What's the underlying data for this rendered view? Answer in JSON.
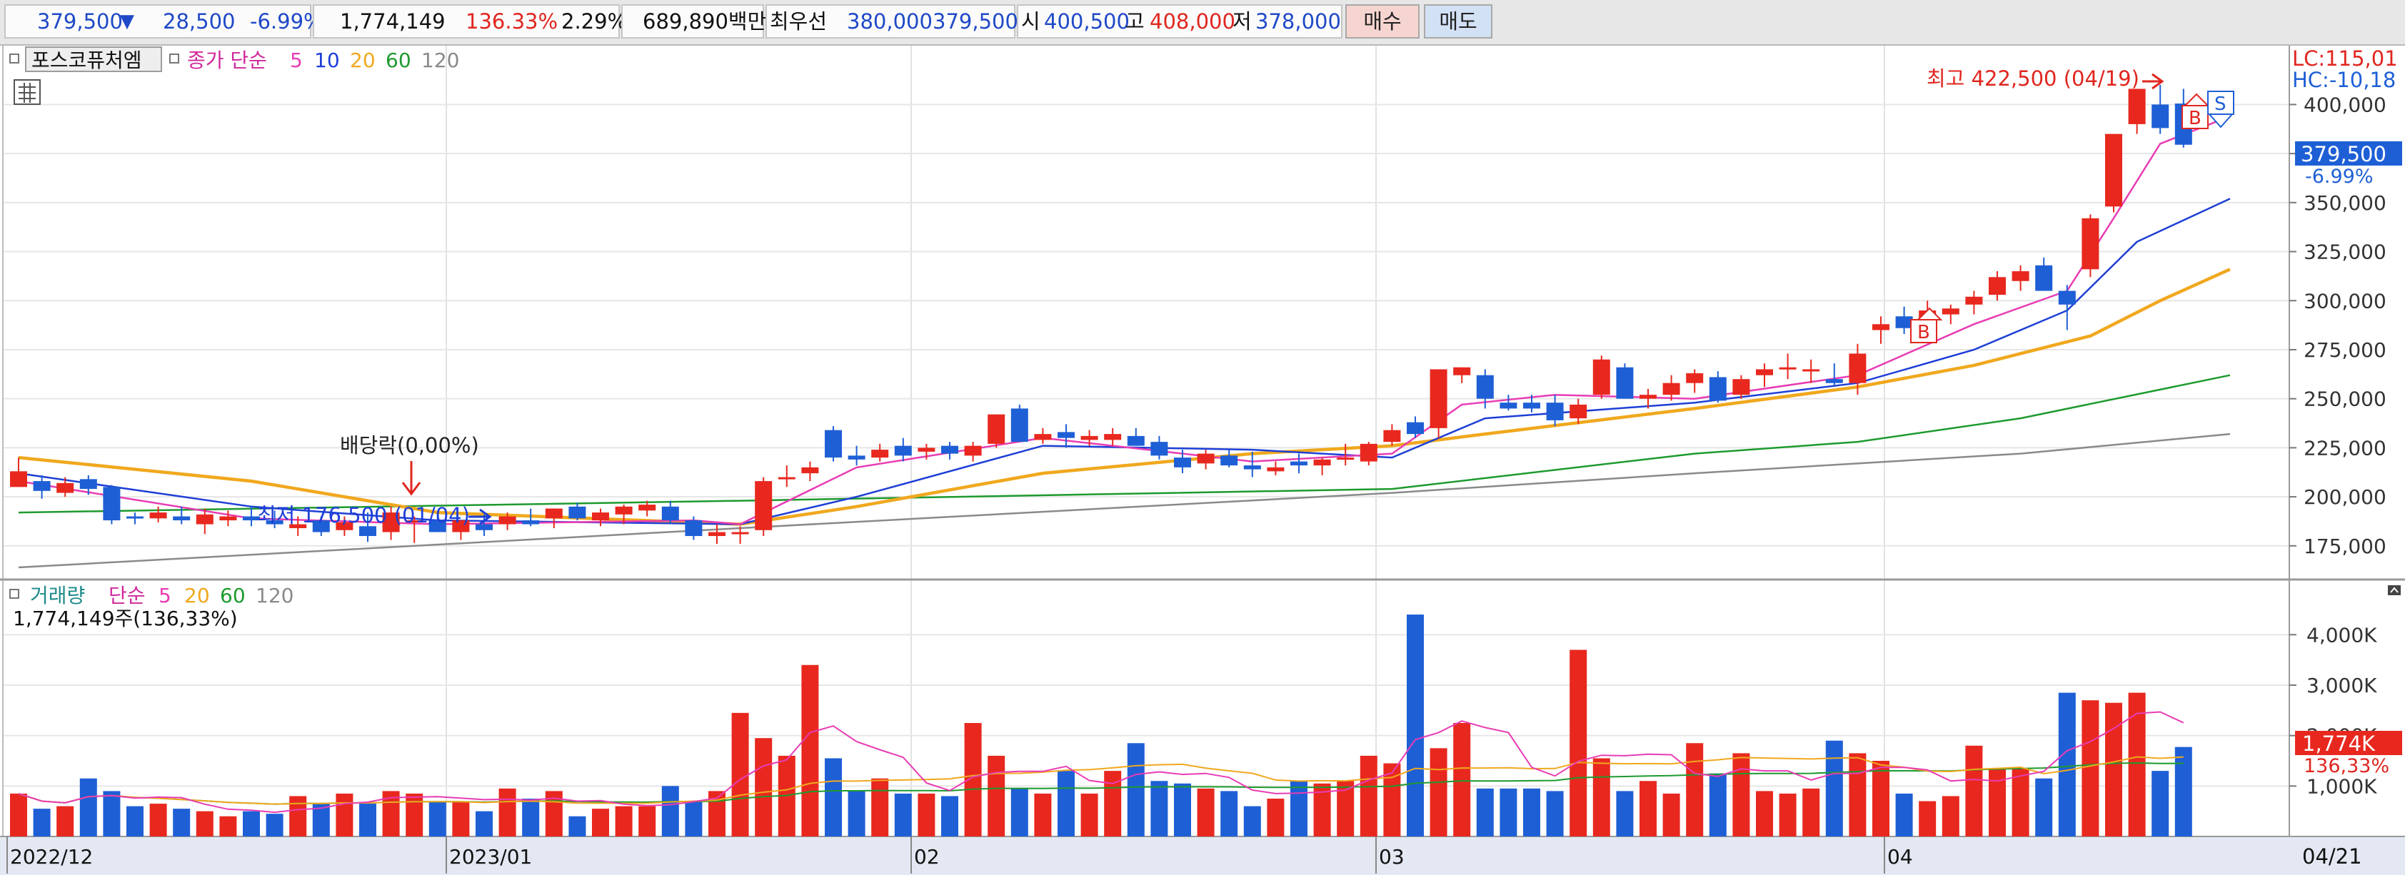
{
  "toolbar": {
    "price": "379,500",
    "change_arrow": "▼",
    "change": "28,500",
    "change_pct": "-6.99%",
    "volume": "1,774,149",
    "volume_ratio": "136.33%",
    "turnover": "2.29%",
    "trade_value": "689,890백만",
    "best_bid_label": "최우선",
    "best_ask": "380,000",
    "best_bid": "379,500",
    "open_label": "시",
    "open": "400,500",
    "high_label": "고",
    "high": "408,000",
    "low_label": "저",
    "low": "378,000",
    "buy_label": "매수",
    "sell_label": "매도"
  },
  "colors": {
    "up": "#e8281e",
    "down": "#1e5fd6",
    "ma5": "#e83cb4",
    "ma10": "#1e3fd6",
    "ma20": "#f0a81e",
    "ma60": "#1e9a2e",
    "ma120": "#8a8a8a"
  },
  "price_panel": {
    "name": "포스코퓨처엠",
    "series_label": "종가 단순",
    "ma_periods": [
      "5",
      "10",
      "20",
      "60",
      "120"
    ],
    "lc_label": "LC:115,01",
    "hc_label": "HC:-10,18",
    "current_price_tag": "379,500",
    "current_pct_tag": "-6.99%",
    "high_annotation": "최고 422,500 (04/19)",
    "low_annotation": "최저 176,500 (01/04)",
    "dividend_annotation": "배당락(0,00%)",
    "buy_marker": "B",
    "sell_marker": "S",
    "y_ticks": [
      "400,000",
      "375,000",
      "350,000",
      "325,000",
      "300,000",
      "275,000",
      "250,000",
      "225,000",
      "200,000",
      "175,000"
    ]
  },
  "volume_panel": {
    "title": "거래량",
    "series_label": "단순",
    "ma_periods": [
      "5",
      "20",
      "60",
      "120"
    ],
    "current_volume": "1,774,149주(136,33%)",
    "current_tag": "1,774K",
    "current_pct_tag": "136,33%",
    "y_ticks": [
      "4,000K",
      "3,000K",
      "2,000K",
      "1,000K"
    ]
  },
  "x_axis": {
    "labels": [
      "2022/12",
      "2023/01",
      "02",
      "03",
      "04"
    ],
    "current_date": "04/21"
  },
  "chart_data": {
    "type": "candlestick",
    "bar_order": [
      "open",
      "high",
      "low",
      "close",
      "volume_k"
    ],
    "bars": [
      [
        205000,
        220000,
        205000,
        213000,
        850
      ],
      [
        208000,
        211000,
        199000,
        203000,
        550
      ],
      [
        202000,
        210000,
        200000,
        207000,
        600
      ],
      [
        209000,
        211000,
        201000,
        204000,
        1150
      ],
      [
        205000,
        206000,
        186000,
        188000,
        900
      ],
      [
        190000,
        192000,
        186000,
        189000,
        600
      ],
      [
        189000,
        195000,
        187000,
        192000,
        650
      ],
      [
        190000,
        195000,
        186000,
        188000,
        550
      ],
      [
        186000,
        194000,
        181000,
        191000,
        500
      ],
      [
        188000,
        193000,
        185000,
        190000,
        400
      ],
      [
        190000,
        195000,
        185000,
        188000,
        500
      ],
      [
        188000,
        193000,
        184000,
        186000,
        450
      ],
      [
        184000,
        190000,
        180000,
        186000,
        800
      ],
      [
        188000,
        190000,
        180000,
        182000,
        650
      ],
      [
        183000,
        190000,
        180000,
        187000,
        850
      ],
      [
        185000,
        192000,
        177000,
        180000,
        650
      ],
      [
        182000,
        195000,
        178000,
        192000,
        900
      ],
      [
        187000,
        190000,
        176500,
        188000,
        850
      ],
      [
        188000,
        192000,
        182000,
        182000,
        700
      ],
      [
        182000,
        188000,
        178000,
        188000,
        700
      ],
      [
        186000,
        191000,
        180000,
        183000,
        500
      ],
      [
        186000,
        192000,
        183000,
        190000,
        950
      ],
      [
        188000,
        194000,
        185000,
        186000,
        750
      ],
      [
        189000,
        194000,
        184000,
        194000,
        900
      ],
      [
        195000,
        197000,
        188000,
        189000,
        400
      ],
      [
        188000,
        194000,
        185000,
        192000,
        550
      ],
      [
        191000,
        196000,
        186000,
        195000,
        600
      ],
      [
        193000,
        198000,
        190000,
        196000,
        600
      ],
      [
        195000,
        198000,
        186000,
        188000,
        1000
      ],
      [
        188000,
        190000,
        178000,
        180000,
        700
      ],
      [
        180000,
        186000,
        176000,
        182000,
        900
      ],
      [
        182000,
        185000,
        176000,
        182000,
        2450
      ],
      [
        183000,
        210000,
        180000,
        208000,
        1950
      ],
      [
        209000,
        216000,
        205000,
        210000,
        1600
      ],
      [
        212000,
        218000,
        208000,
        215000,
        3400
      ],
      [
        234000,
        236000,
        218000,
        220000,
        1550
      ],
      [
        221000,
        226000,
        216000,
        219000,
        900
      ],
      [
        220000,
        227000,
        218000,
        224000,
        1150
      ],
      [
        226000,
        230000,
        218000,
        221000,
        850
      ],
      [
        223000,
        227000,
        219000,
        225000,
        850
      ],
      [
        226000,
        228000,
        219000,
        222000,
        800
      ],
      [
        221000,
        228000,
        218000,
        226000,
        2250
      ],
      [
        227000,
        242000,
        225000,
        242000,
        1600
      ],
      [
        245000,
        247000,
        228000,
        228000,
        950
      ],
      [
        229000,
        235000,
        227000,
        232000,
        850
      ],
      [
        233000,
        237000,
        225000,
        230000,
        1300
      ],
      [
        229000,
        234000,
        226000,
        231000,
        850
      ],
      [
        229000,
        235000,
        226000,
        232000,
        1300
      ],
      [
        231000,
        235000,
        226000,
        226000,
        1850
      ],
      [
        228000,
        231000,
        219000,
        221000,
        1100
      ],
      [
        220000,
        224000,
        212000,
        215000,
        1050
      ],
      [
        217000,
        224000,
        214000,
        222000,
        950
      ],
      [
        221000,
        224000,
        215000,
        216000,
        900
      ],
      [
        216000,
        223000,
        210000,
        214000,
        600
      ],
      [
        213000,
        218000,
        211000,
        215000,
        750
      ],
      [
        218000,
        222000,
        212000,
        216000,
        1100
      ],
      [
        216000,
        220000,
        211000,
        219000,
        1050
      ],
      [
        220000,
        227000,
        216000,
        220000,
        1100
      ],
      [
        218000,
        228000,
        216000,
        227000,
        1600
      ],
      [
        228000,
        237000,
        226000,
        234000,
        1450
      ],
      [
        238000,
        241000,
        230000,
        232000,
        4400
      ],
      [
        235000,
        265000,
        230000,
        265000,
        1750
      ],
      [
        262000,
        266000,
        258000,
        266000,
        2250
      ],
      [
        262000,
        265000,
        245000,
        250000,
        950
      ],
      [
        248000,
        252000,
        244000,
        245000,
        950
      ],
      [
        248000,
        252000,
        243000,
        245000,
        950
      ],
      [
        248000,
        252000,
        236000,
        239000,
        900
      ],
      [
        240000,
        250000,
        237000,
        247000,
        3700
      ],
      [
        252000,
        272000,
        250000,
        270000,
        1550
      ],
      [
        266000,
        268000,
        250000,
        250000,
        900
      ],
      [
        250000,
        255000,
        245000,
        252000,
        1100
      ],
      [
        252000,
        262000,
        249000,
        258000,
        850
      ],
      [
        258000,
        265000,
        253000,
        263000,
        1850
      ],
      [
        261000,
        264000,
        248000,
        249000,
        1250
      ],
      [
        252000,
        262000,
        250000,
        260000,
        1650
      ],
      [
        262000,
        268000,
        256000,
        265000,
        900
      ],
      [
        266000,
        273000,
        260000,
        266000,
        850
      ],
      [
        264000,
        270000,
        258000,
        265000,
        950
      ],
      [
        260000,
        268000,
        256000,
        258000,
        1900
      ],
      [
        258000,
        278000,
        252000,
        273000,
        1650
      ],
      [
        285000,
        292000,
        278000,
        288000,
        1500
      ],
      [
        292000,
        297000,
        283000,
        286000,
        850
      ],
      [
        290000,
        300000,
        285000,
        295000,
        700
      ],
      [
        293000,
        298000,
        288000,
        296000,
        800
      ],
      [
        298000,
        305000,
        293000,
        302000,
        1800
      ],
      [
        303000,
        315000,
        300000,
        312000,
        1350
      ],
      [
        310000,
        318000,
        305000,
        315000,
        1350
      ],
      [
        318000,
        322000,
        305000,
        305000,
        1150
      ],
      [
        305000,
        308000,
        285000,
        298000,
        2850
      ],
      [
        316000,
        344000,
        312000,
        342000,
        2700
      ],
      [
        348000,
        385000,
        345000,
        385000,
        2650
      ],
      [
        390000,
        408000,
        385000,
        408000,
        2850
      ],
      [
        400000,
        410000,
        385000,
        388000,
        1300
      ],
      [
        400500,
        408000,
        378000,
        379500,
        1774
      ]
    ],
    "y_range": [
      160000,
      430000
    ],
    "volume_y_range_k": [
      0,
      4500
    ],
    "ma_lines": {
      "5": [
        [
          0,
          208000
        ],
        [
          10,
          189000
        ],
        [
          18,
          186000
        ],
        [
          29,
          188000
        ],
        [
          31,
          186000
        ],
        [
          36,
          215000
        ],
        [
          44,
          230000
        ],
        [
          53,
          218000
        ],
        [
          59,
          222000
        ],
        [
          62,
          247000
        ],
        [
          66,
          252000
        ],
        [
          72,
          250000
        ],
        [
          79,
          262000
        ],
        [
          84,
          288000
        ],
        [
          88,
          305000
        ],
        [
          90,
          342000
        ],
        [
          92,
          380000
        ],
        [
          95,
          394000
        ]
      ],
      "10": [
        [
          0,
          212000
        ],
        [
          10,
          195000
        ],
        [
          18,
          188000
        ],
        [
          31,
          186000
        ],
        [
          36,
          200000
        ],
        [
          44,
          226000
        ],
        [
          53,
          224000
        ],
        [
          59,
          220000
        ],
        [
          63,
          240000
        ],
        [
          72,
          248000
        ],
        [
          79,
          258000
        ],
        [
          84,
          275000
        ],
        [
          88,
          295000
        ],
        [
          91,
          330000
        ],
        [
          95,
          352000
        ]
      ],
      "20": [
        [
          0,
          220000
        ],
        [
          10,
          208000
        ],
        [
          18,
          192000
        ],
        [
          31,
          186000
        ],
        [
          36,
          195000
        ],
        [
          44,
          212000
        ],
        [
          53,
          222000
        ],
        [
          59,
          226000
        ],
        [
          63,
          232000
        ],
        [
          72,
          245000
        ],
        [
          79,
          256000
        ],
        [
          84,
          267000
        ],
        [
          89,
          282000
        ],
        [
          92,
          300000
        ],
        [
          95,
          316000
        ]
      ],
      "60": [
        [
          0,
          192000
        ],
        [
          31,
          198000
        ],
        [
          59,
          204000
        ],
        [
          72,
          222000
        ],
        [
          79,
          228000
        ],
        [
          86,
          240000
        ],
        [
          95,
          262000
        ]
      ],
      "120": [
        [
          0,
          164000
        ],
        [
          31,
          184000
        ],
        [
          59,
          202000
        ],
        [
          72,
          212000
        ],
        [
          86,
          222000
        ],
        [
          95,
          232000
        ]
      ]
    }
  }
}
